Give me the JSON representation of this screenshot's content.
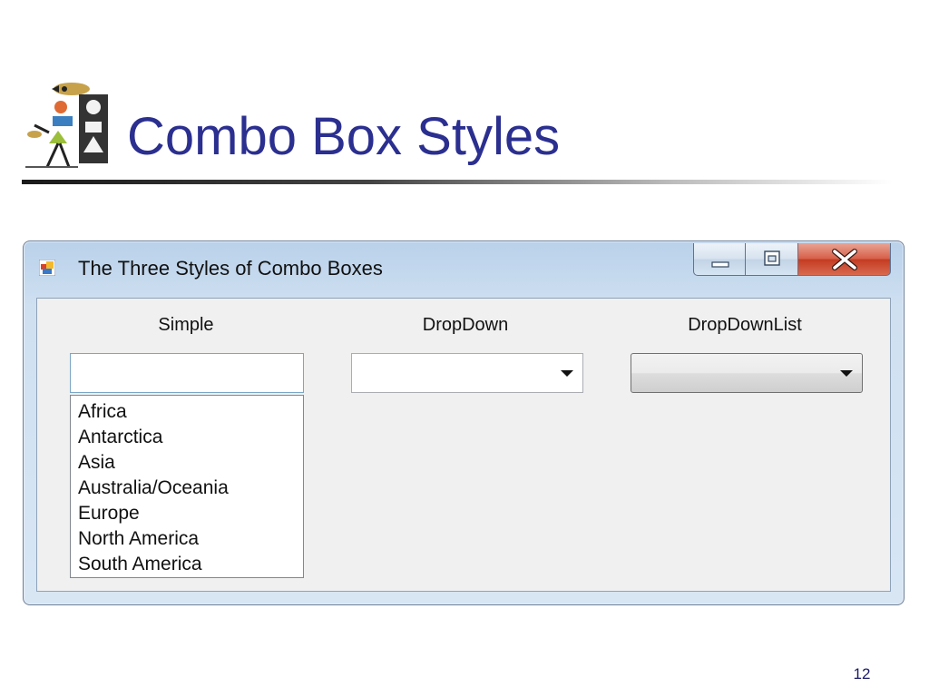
{
  "slide": {
    "title": "Combo Box Styles",
    "number": "12"
  },
  "window": {
    "title": "The Three Styles of Combo Boxes",
    "caption_buttons": {
      "minimize_icon": "minimize-icon",
      "maximize_icon": "restore-icon",
      "close_icon": "close-icon"
    },
    "accent_close": "#d0452a"
  },
  "combo_boxes": {
    "simple": {
      "label": "Simple",
      "value": "",
      "items": [
        "Africa",
        "Antarctica",
        "Asia",
        "Australia/Oceania",
        "Europe",
        "North America",
        "South America"
      ]
    },
    "dropdown": {
      "label": "DropDown",
      "value": ""
    },
    "dropdownlist": {
      "label": "DropDownList",
      "value": ""
    }
  },
  "colors": {
    "title": "#2b2f8f",
    "window_frame": "#b9d1ea",
    "client_bg": "#f0f0f0"
  }
}
